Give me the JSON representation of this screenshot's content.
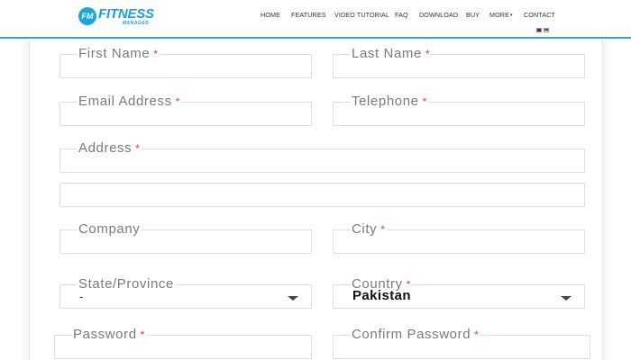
{
  "header": {
    "logo": {
      "badge": "FM",
      "name": "FITNESS",
      "sub": "MANAGER"
    },
    "nav": [
      "HOME",
      "FEATURES",
      "VIDEO TUTORIAL",
      "FAQ",
      "DOWNLOAD",
      "BUY",
      "MORE",
      "CONTACT"
    ],
    "more_caret": "▾",
    "flags": [
      "flag-uk",
      "flag-rs"
    ]
  },
  "form": {
    "required_mark": "*",
    "first_name": {
      "label": "First Name",
      "value": ""
    },
    "last_name": {
      "label": "Last Name",
      "value": ""
    },
    "email": {
      "label": "Email Address",
      "value": ""
    },
    "telephone": {
      "label": "Telephone",
      "value": ""
    },
    "address": {
      "label": "Address",
      "value": ""
    },
    "address2": {
      "value": ""
    },
    "company": {
      "label": "Company",
      "value": ""
    },
    "city": {
      "label": "City",
      "value": ""
    },
    "state": {
      "label": "State/Province",
      "value": "-"
    },
    "country": {
      "label": "Country",
      "value": "Pakistan"
    },
    "password": {
      "label": "Password"
    },
    "confirm_password": {
      "label": "Confirm Password"
    }
  },
  "colors": {
    "accent": "#2fa8d6",
    "required": "#e23b3b",
    "label": "#7a7a7a"
  }
}
